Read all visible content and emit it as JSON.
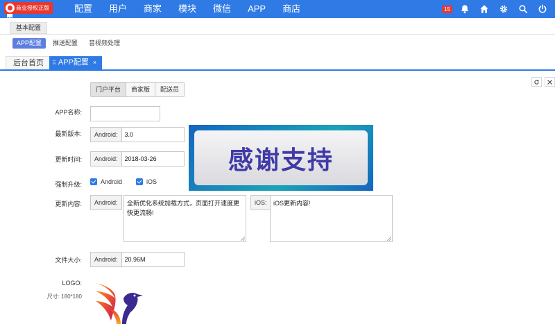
{
  "brand": {
    "label": "商业授权正版"
  },
  "nav": {
    "items": [
      "配置",
      "用户",
      "商家",
      "模块",
      "微信",
      "APP",
      "商店"
    ]
  },
  "header": {
    "notification_count": "15"
  },
  "section_tab": "基本配置",
  "subtabs": {
    "items": [
      {
        "label": "APP配置"
      },
      {
        "label": "推送配置"
      },
      {
        "label": "音视频处理"
      }
    ]
  },
  "page_tabs": {
    "home": "后台首页",
    "current": "APP配置",
    "grip": "⠿",
    "close": "×"
  },
  "platform": {
    "options": [
      "门户平台",
      "商家版",
      "配送员"
    ],
    "selected": "门户平台"
  },
  "form": {
    "app_name": {
      "label": "APP名称:",
      "value": ""
    },
    "version": {
      "label": "最新版本:",
      "addon": "Android:",
      "value": "3.0"
    },
    "update_time": {
      "label": "更新时间:",
      "addon": "Android:",
      "value": "2018-03-26"
    },
    "force_update": {
      "label": "强制升级:",
      "android": "Android",
      "ios": "iOS",
      "android_checked": true,
      "ios_checked": true
    },
    "update_content": {
      "label": "更新内容:",
      "android_addon": "Android:",
      "android_value": "全新优化系统加载方式，页面打开速度更快更流畅!",
      "ios_addon": "iOS:",
      "ios_value": "iOS更新内容!"
    },
    "file_size": {
      "label": "文件大小:",
      "addon": "Android:",
      "value": "20.96M"
    },
    "logo": {
      "label": "LOGO:",
      "size_note": "尺寸: 180*180"
    }
  },
  "banner": {
    "text": "感谢支持"
  },
  "colors": {
    "primary": "#2f7ae5",
    "brand_red": "#e8372e",
    "banner_text": "#3f3aa6"
  }
}
